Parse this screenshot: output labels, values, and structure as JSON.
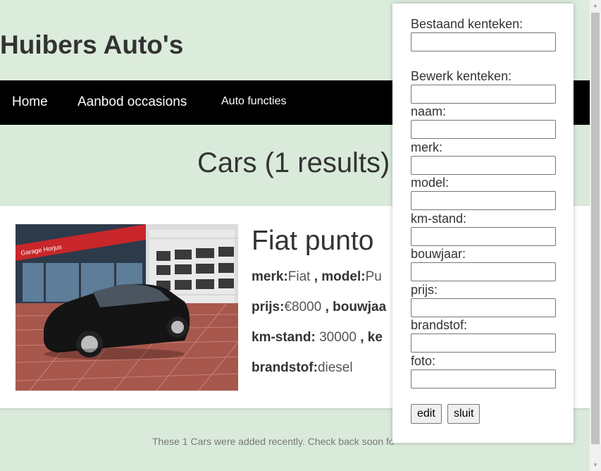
{
  "site": {
    "title": "Huibers Auto's"
  },
  "nav": {
    "items": [
      "Home",
      "Aanbod occasions",
      "Auto functies"
    ]
  },
  "results": {
    "heading": "Cars (1 results)"
  },
  "car": {
    "name": "Fiat punto",
    "photo_sign_text": "Garage Horjus",
    "labels": {
      "merk": "merk:",
      "model": "model:",
      "prijs": "prijs:",
      "bouwjaar": "bouwjaa",
      "km_stand": "km-stand:",
      "kenteken": "ke",
      "brandstof": "brandstof:"
    },
    "values": {
      "merk": "Fiat",
      "model": "Pu",
      "prijs": "€8000",
      "km_stand": "30000",
      "brandstof": "diesel"
    },
    "separator": " , "
  },
  "footer": {
    "text": "These 1 Cars were added recently. Check back soon fo"
  },
  "edit_panel": {
    "fields": [
      {
        "label": "Bestaand kenteken:",
        "value": ""
      },
      {
        "label": "Bewerk kenteken:",
        "value": ""
      },
      {
        "label": "naam:",
        "value": ""
      },
      {
        "label": "merk:",
        "value": ""
      },
      {
        "label": "model:",
        "value": ""
      },
      {
        "label": "km-stand:",
        "value": ""
      },
      {
        "label": "bouwjaar:",
        "value": ""
      },
      {
        "label": "prijs:",
        "value": ""
      },
      {
        "label": "brandstof:",
        "value": ""
      },
      {
        "label": "foto:",
        "value": ""
      }
    ],
    "buttons": {
      "edit": "edit",
      "sluit": "sluit"
    }
  },
  "colors": {
    "page_bg": "#d9eadb",
    "navbar_bg": "#000000",
    "text": "#333333"
  }
}
